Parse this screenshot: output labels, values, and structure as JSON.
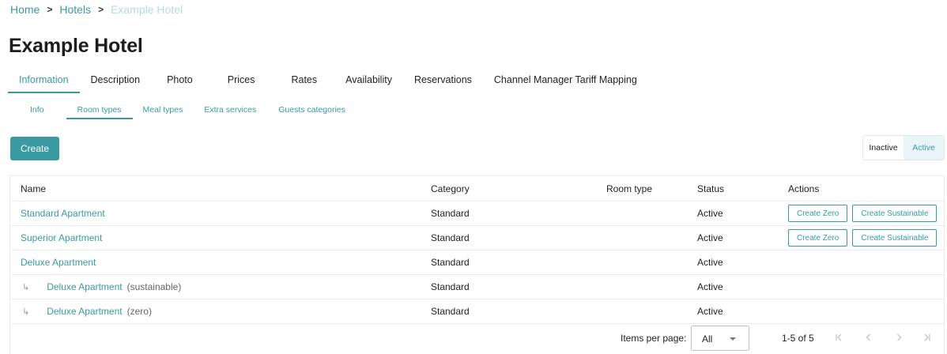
{
  "breadcrumb": {
    "home": "Home",
    "hotels": "Hotels",
    "current": "Example Hotel",
    "separator": ">"
  },
  "page_title": "Example Hotel",
  "main_tabs": [
    {
      "label": "Information",
      "active": true
    },
    {
      "label": "Description"
    },
    {
      "label": "Photo"
    },
    {
      "label": "Prices"
    },
    {
      "label": "Rates"
    },
    {
      "label": "Availability"
    },
    {
      "label": "Reservations"
    },
    {
      "label": "Channel Manager Tariff Mapping"
    }
  ],
  "sub_tabs": [
    {
      "label": "Info"
    },
    {
      "label": "Room types",
      "active": true
    },
    {
      "label": "Meal types"
    },
    {
      "label": "Extra services"
    },
    {
      "label": "Guests categories"
    }
  ],
  "create_label": "Create",
  "status_toggle": {
    "inactive": "Inactive",
    "active": "Active",
    "selected": "Active"
  },
  "table": {
    "columns": {
      "name": "Name",
      "category": "Category",
      "room_type": "Room type",
      "status": "Status",
      "actions": "Actions"
    },
    "action_labels": {
      "zero": "Create Zero",
      "sustainable": "Create Sustainable"
    },
    "rows": [
      {
        "name": "Standard Apartment",
        "category": "Standard",
        "room_type": "",
        "status": "Active"
      },
      {
        "name": "Superior Apartment",
        "category": "Standard",
        "room_type": "",
        "status": "Active"
      },
      {
        "name": "Deluxe Apartment",
        "category": "Standard",
        "room_type": "",
        "status": "Active"
      },
      {
        "name": "Deluxe Apartment",
        "suffix": "(sustainable)",
        "category": "Standard",
        "room_type": "",
        "status": "Active"
      },
      {
        "name": "Deluxe Apartment",
        "suffix": "(zero)",
        "category": "Standard",
        "room_type": "",
        "status": "Active"
      }
    ]
  },
  "pagination": {
    "items_per_page_label": "Items per page:",
    "items_per_page_value": "All",
    "range_label": "1-5 of 5"
  },
  "icons": {
    "child_arrow": "↳",
    "first_page": "first-page-icon",
    "prev_page": "chevron-left-icon",
    "next_page": "chevron-right-icon",
    "last_page": "last-page-icon"
  },
  "colors": {
    "accent": "#3a9aa1",
    "accent_light": "#e8f4f5",
    "breadcrumb_current": "#b6dadd"
  }
}
